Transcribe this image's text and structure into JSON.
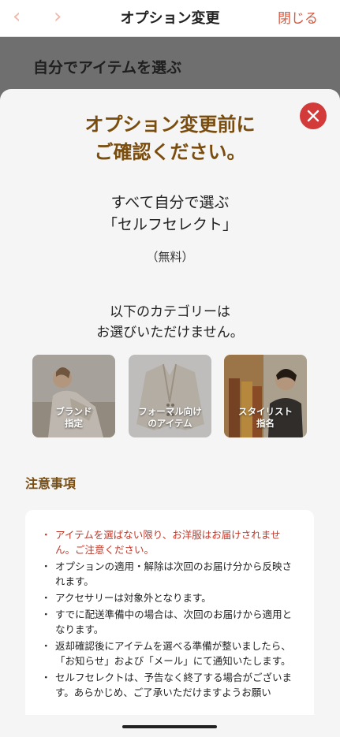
{
  "header": {
    "back_icon": "chevron-left-icon",
    "forward_icon": "chevron-right-icon",
    "title": "オプション変更",
    "close_label": "閉じる",
    "accent_color": "#d9573f"
  },
  "underlay": {
    "title": "自分でアイテムを選ぶ"
  },
  "modal": {
    "close_icon": "close-icon",
    "title_line1": "オプション変更前に",
    "title_line2": "ご確認ください。",
    "subtitle_line1": "すべて自分で選ぶ",
    "subtitle_line2": "「セルフセレクト」",
    "price": "（無料）",
    "unavailable_line1": "以下のカテゴリーは",
    "unavailable_line2": "お選びいただけません。",
    "categories": [
      {
        "line1": "ブランド",
        "line2": "指定"
      },
      {
        "line1": "フォーマル向け",
        "line2": "のアイテム"
      },
      {
        "line1": "スタイリスト",
        "line2": "指名"
      }
    ],
    "notes_heading": "注意事項",
    "notes": [
      "アイテムを選ばない限り、お洋服はお届けされません。ご注意ください。",
      "オプションの適用・解除は次回のお届け分から反映されます。",
      "アクセサリーは対象外となります。",
      "すでに配送準備中の場合は、次回のお届けから適用となります。",
      "返却確認後にアイテムを選べる準備が整いましたら、「お知らせ」および「メール」にて通知いたします。",
      "セルフセレクトは、予告なく終了する場合がございます。あらかじめ、ご了承いただけますようお願い"
    ],
    "title_color": "#7a4d0e",
    "warning_color": "#c0392b"
  }
}
